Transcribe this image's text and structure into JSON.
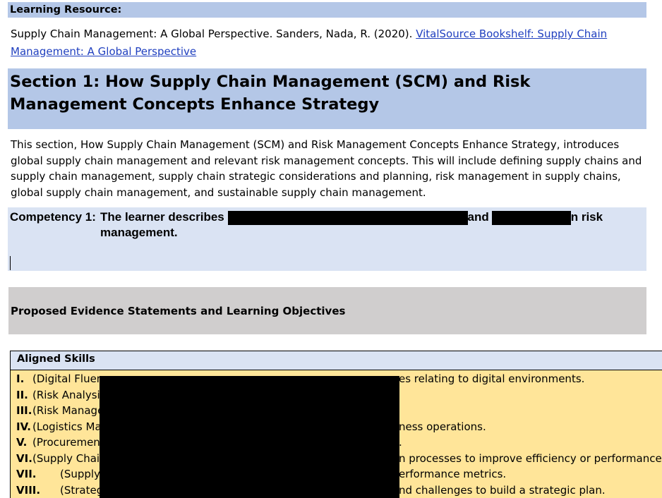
{
  "learning_resource": {
    "label": "Learning Resource:",
    "citation": "Supply Chain Management: A Global Perspective. Sanders, Nada, R. (2020). ",
    "link_text": "VitalSource Bookshelf: Supply Chain Management: A Global Perspective"
  },
  "section": {
    "title": "Section 1: How Supply Chain Management (SCM) and Risk Management Concepts Enhance Strategy",
    "intro": "This section, How Supply Chain Management (SCM) and Risk Management Concepts Enhance Strategy, introduces global supply chain management and relevant risk management concepts. This will include defining supply chains and supply chain management, supply chain strategic considerations and planning, risk management in supply chains, global supply chain management, and sustainable supply chain management."
  },
  "competency": {
    "label": "Competency 1:",
    "part1": "The learner describes",
    "part2": "and",
    "part3": "n risk",
    "part4": "management."
  },
  "proposed": {
    "heading": "Proposed Evidence Statements and Learning Objectives"
  },
  "skills": {
    "heading": "Aligned Skills",
    "rows": [
      {
        "num": "I.",
        "lead": "(Digital Fluen",
        "tail": "es relating to digital environments."
      },
      {
        "num": "II.",
        "lead": "(Risk Analysis",
        "tail": ""
      },
      {
        "num": "III.",
        "lead": "(Risk Manage",
        "tail": ""
      },
      {
        "num": "IV.",
        "lead": "(Logistics Ma",
        "tail": "ness operations."
      },
      {
        "num": "V.",
        "lead": "(Procuremen",
        "tail": "."
      },
      {
        "num": "VI.",
        "lead": "(Supply Chai",
        "tail": "n processes to improve efficiency or performance."
      },
      {
        "num": "VII.",
        "lead": "(Supply",
        "tail": "erformance metrics."
      },
      {
        "num": "VIII.",
        "lead": "(Strateg",
        "tail": "nd challenges to build a strategic plan."
      }
    ]
  }
}
